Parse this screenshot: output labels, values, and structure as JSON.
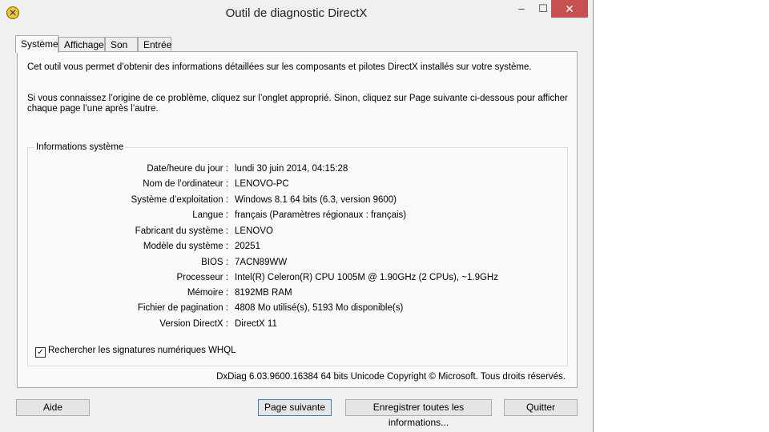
{
  "window": {
    "title": "Outil de diagnostic DirectX",
    "controls": {
      "minimize": "–",
      "maximize": "☐",
      "close": "✕"
    }
  },
  "tabs": [
    {
      "label": "Système",
      "active": true
    },
    {
      "label": "Affichage"
    },
    {
      "label": "Son"
    },
    {
      "label": "Entrée"
    }
  ],
  "intro": {
    "line1": "Cet outil vous permet d’obtenir des informations détaillées sur les composants et pilotes DirectX installés sur votre système.",
    "line2": "Si vous connaissez l’origine de ce problème, cliquez sur l’onglet approprié. Sinon, cliquez sur Page suivante ci-dessous pour afficher chaque page l’une après l’autre."
  },
  "system_info": {
    "group_label": "Informations système",
    "rows": [
      {
        "label": "Date/heure du jour :",
        "value": "lundi 30 juin 2014, 04:15:28"
      },
      {
        "label": "Nom de l’ordinateur :",
        "value": "LENOVO-PC"
      },
      {
        "label": "Système d’exploitation :",
        "value": "Windows 8.1 64 bits (6.3, version 9600)"
      },
      {
        "label": "Langue :",
        "value": "français (Paramètres régionaux : français)"
      },
      {
        "label": "Fabricant du système :",
        "value": "LENOVO"
      },
      {
        "label": "Modèle du système :",
        "value": "20251"
      },
      {
        "label": "BIOS :",
        "value": "7ACN89WW"
      },
      {
        "label": "Processeur :",
        "value": "Intel(R) Celeron(R) CPU 1005M @ 1.90GHz (2 CPUs), ~1.9GHz"
      },
      {
        "label": "Mémoire :",
        "value": "8192MB RAM"
      },
      {
        "label": "Fichier de pagination :",
        "value": "4808 Mo utilisé(s), 5193 Mo disponible(s)"
      },
      {
        "label": "Version DirectX :",
        "value": "DirectX 11"
      }
    ]
  },
  "whql": {
    "label": "Rechercher les signatures numériques WHQL",
    "checked": true
  },
  "copyright": "DxDiag 6.03.9600.16384 64 bits Unicode Copyright © Microsoft. Tous droits réservés.",
  "buttons": {
    "help": "Aide",
    "next_page": "Page suivante",
    "save_all": "Enregistrer toutes les informations...",
    "quit": "Quitter"
  }
}
